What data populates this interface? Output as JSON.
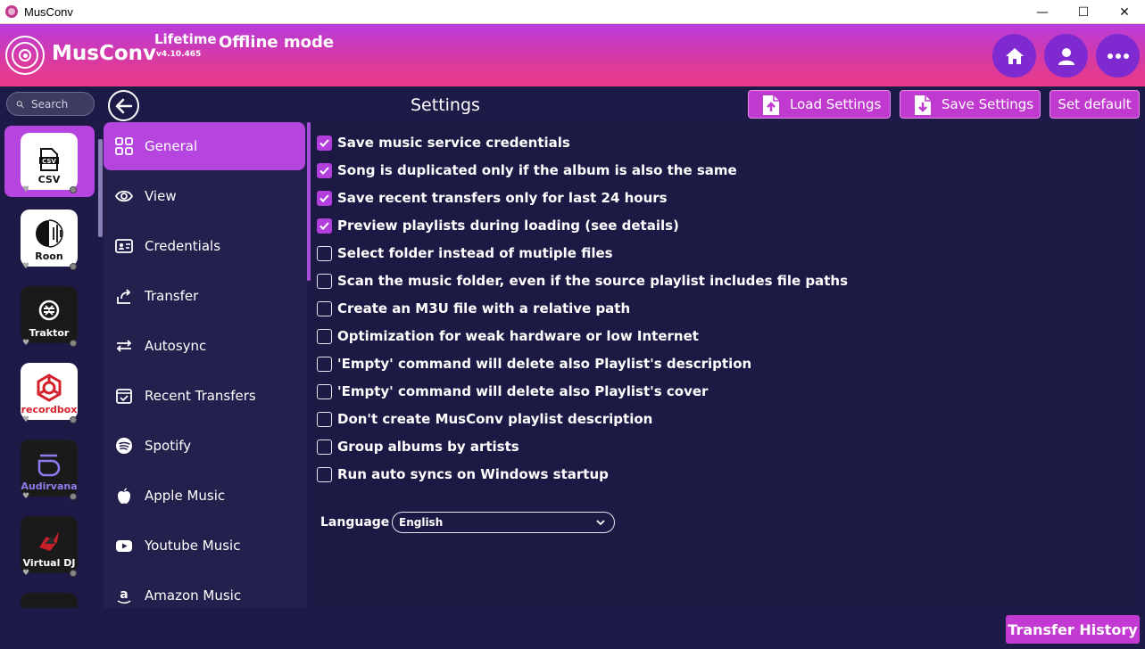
{
  "window": {
    "title": "MusConv",
    "minimize": "—",
    "maximize": "☐",
    "close": "✕"
  },
  "header": {
    "brand": "MusConv",
    "plan": "Lifetime",
    "version": "v4.10.465",
    "mode": "Offline mode",
    "buttons": [
      "home-icon",
      "user-icon",
      "more-icon"
    ]
  },
  "search": {
    "placeholder": "Search"
  },
  "services": [
    {
      "label": "CSV",
      "active": true
    },
    {
      "label": "Roon"
    },
    {
      "label": "Traktor"
    },
    {
      "label": "recordbox"
    },
    {
      "label": "Audirvana"
    },
    {
      "label": "Virtual DJ"
    }
  ],
  "settings": {
    "title": "Settings",
    "load_label": "Load Settings",
    "save_label": "Save Settings",
    "default_label": "Set default"
  },
  "categories": [
    {
      "label": "General",
      "icon": "grid-icon",
      "active": true
    },
    {
      "label": "View",
      "icon": "eye-icon"
    },
    {
      "label": "Credentials",
      "icon": "id-card-icon"
    },
    {
      "label": "Transfer",
      "icon": "share-icon"
    },
    {
      "label": "Autosync",
      "icon": "sync-icon"
    },
    {
      "label": "Recent Transfers",
      "icon": "calendar-check-icon"
    },
    {
      "label": "Spotify",
      "icon": "spotify-icon"
    },
    {
      "label": "Apple Music",
      "icon": "apple-icon"
    },
    {
      "label": "Youtube Music",
      "icon": "youtube-icon"
    },
    {
      "label": "Amazon Music",
      "icon": "amazon-icon"
    }
  ],
  "options": [
    {
      "label": "Save music service credentials",
      "checked": true
    },
    {
      "label": "Song is duplicated only if the album is also the same",
      "checked": true
    },
    {
      "label": "Save recent transfers only for last 24 hours",
      "checked": true
    },
    {
      "label": "Preview playlists during loading (see details)",
      "checked": true
    },
    {
      "label": "Select folder instead of mutiple files",
      "checked": false
    },
    {
      "label": "Scan the music folder, even if the source playlist includes file paths",
      "checked": false
    },
    {
      "label": "Create an M3U file with a relative path",
      "checked": false
    },
    {
      "label": "Optimization for weak hardware or low Internet",
      "checked": false
    },
    {
      "label": "'Empty' command will delete also Playlist's description",
      "checked": false
    },
    {
      "label": "'Empty' command will delete also Playlist's cover",
      "checked": false
    },
    {
      "label": "Don't create MusConv playlist description",
      "checked": false
    },
    {
      "label": "Group albums by artists",
      "checked": false
    },
    {
      "label": "Run auto syncs on Windows startup",
      "checked": false
    }
  ],
  "language": {
    "label": "Language",
    "value": "English"
  },
  "transfer_history": "Transfer History",
  "colors": {
    "accent": "#b644df",
    "background": "#1e1a48",
    "header_start": "#b93bdc",
    "header_end": "#ea3a88"
  }
}
